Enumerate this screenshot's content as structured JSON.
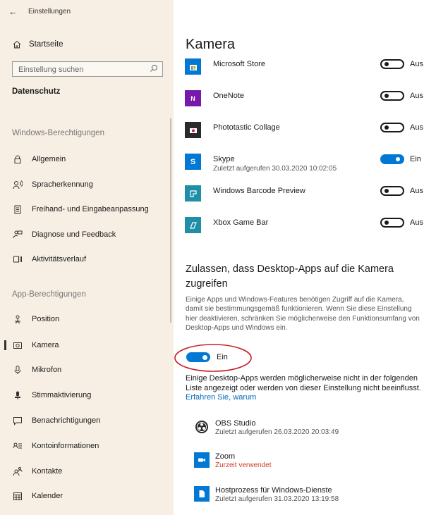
{
  "window": {
    "title": "Einstellungen"
  },
  "sidebar": {
    "home_label": "Startseite",
    "search_placeholder": "Einstellung suchen",
    "section_title": "Datenschutz",
    "windows_group": "Windows-Berechtigungen",
    "windows_items": [
      {
        "label": "Allgemein",
        "icon": "lock-icon"
      },
      {
        "label": "Spracherkennung",
        "icon": "speech-icon"
      },
      {
        "label": "Freihand- und Eingabeanpassung",
        "icon": "notepad-icon"
      },
      {
        "label": "Diagnose und Feedback",
        "icon": "feedback-icon"
      },
      {
        "label": "Aktivitätsverlauf",
        "icon": "timeline-icon"
      }
    ],
    "app_group": "App-Berechtigungen",
    "app_items": [
      {
        "label": "Position",
        "icon": "location-icon"
      },
      {
        "label": "Kamera",
        "icon": "camera-icon",
        "active": true
      },
      {
        "label": "Mikrofon",
        "icon": "microphone-icon"
      },
      {
        "label": "Stimmaktivierung",
        "icon": "voice-activation-icon"
      },
      {
        "label": "Benachrichtigungen",
        "icon": "notification-icon"
      },
      {
        "label": "Kontoinformationen",
        "icon": "account-info-icon"
      },
      {
        "label": "Kontakte",
        "icon": "contacts-icon"
      },
      {
        "label": "Kalender",
        "icon": "calendar-icon"
      }
    ]
  },
  "main": {
    "title": "Kamera",
    "apps": [
      {
        "name": "Microsoft Store",
        "sub": "",
        "state": "Aus",
        "on": false,
        "color": "#0078d4",
        "icon": "store-icon"
      },
      {
        "name": "OneNote",
        "sub": "",
        "state": "Aus",
        "on": false,
        "color": "#7719aa",
        "icon": "onenote-icon"
      },
      {
        "name": "Phototastic Collage",
        "sub": "",
        "state": "Aus",
        "on": false,
        "color": "#2b2b2b",
        "icon": "collage-icon"
      },
      {
        "name": "Skype",
        "sub": "Zuletzt aufgerufen 30.03.2020 10:02:05",
        "state": "Ein",
        "on": true,
        "color": "#0078d4",
        "icon": "skype-icon"
      },
      {
        "name": "Windows Barcode Preview",
        "sub": "",
        "state": "Aus",
        "on": false,
        "color": "#1f8fa8",
        "icon": "barcode-icon"
      },
      {
        "name": "Xbox Game Bar",
        "sub": "",
        "state": "Aus",
        "on": false,
        "color": "#1f8fa8",
        "icon": "xbox-icon"
      }
    ],
    "desktop_section": {
      "heading": "Zulassen, dass Desktop-Apps auf die Kamera zugreifen",
      "description": "Einige Apps und Windows-Features benötigen Zugriff auf die Kamera, damit sie bestimmungsgemäß funktionieren. Wenn Sie diese Einstellung hier deaktivieren, schränken Sie möglicherweise den Funktionsumfang von Desktop-Apps und Windows ein.",
      "toggle_label": "Ein",
      "note": "Einige Desktop-Apps werden möglicherweise nicht in der folgenden Liste angezeigt oder werden von dieser Einstellung nicht beeinflusst.",
      "note_link": "Erfahren Sie, warum"
    },
    "desktop_apps": [
      {
        "name": "OBS Studio",
        "sub": "Zuletzt aufgerufen 26.03.2020 20:03:49",
        "red": false,
        "color": "#2b2b2b",
        "icon": "obs-icon"
      },
      {
        "name": "Zoom",
        "sub": "Zurzeit verwendet",
        "red": true,
        "color": "#0078d4",
        "icon": "zoom-icon"
      },
      {
        "name": "Hostprozess für Windows-Dienste",
        "sub": "Zuletzt aufgerufen 31.03.2020 13:19:58",
        "red": false,
        "color": "#0078d4",
        "icon": "document-icon"
      }
    ],
    "annotation_color": "#c8202a"
  }
}
